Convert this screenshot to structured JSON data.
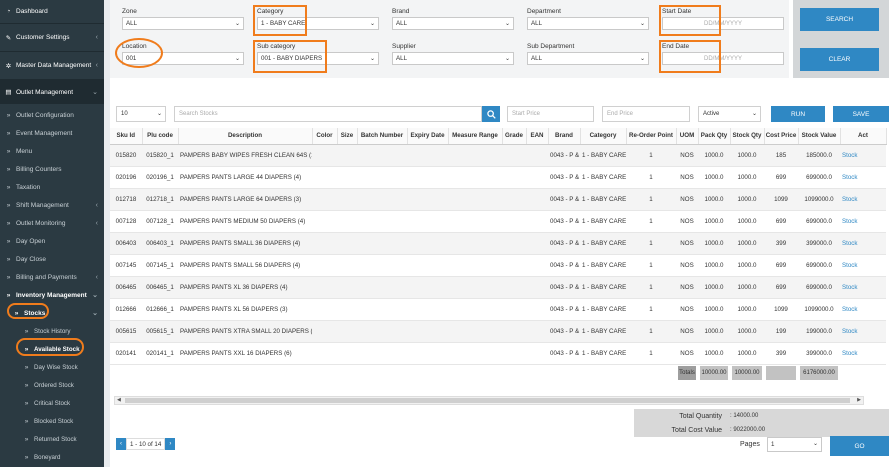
{
  "sidebar": {
    "items": [
      {
        "label": "Dashboard",
        "icon": "tachometer-icon"
      },
      {
        "label": "Customer Settings",
        "icon": "wrench-icon"
      },
      {
        "label": "Master Data Management",
        "icon": "gear-icon"
      },
      {
        "label": "Outlet Management",
        "icon": "store-icon"
      },
      {
        "label": "Outlet Configuration"
      },
      {
        "label": "Event Management"
      },
      {
        "label": "Menu"
      },
      {
        "label": "Billing Counters"
      },
      {
        "label": "Taxation"
      },
      {
        "label": "Shift Management"
      },
      {
        "label": "Outlet Monitoring"
      },
      {
        "label": "Day Open"
      },
      {
        "label": "Day Close"
      },
      {
        "label": "Billing and Payments"
      },
      {
        "label": "Inventory Management"
      },
      {
        "label": "Stocks"
      },
      {
        "label": "Stock History"
      },
      {
        "label": "Available Stock"
      },
      {
        "label": "Day Wise Stock"
      },
      {
        "label": "Ordered Stock"
      },
      {
        "label": "Critical Stock"
      },
      {
        "label": "Blocked Stock"
      },
      {
        "label": "Returned Stock"
      },
      {
        "label": "Boneyard"
      }
    ]
  },
  "filters": {
    "zone": {
      "label": "Zone",
      "value": "ALL"
    },
    "category": {
      "label": "Category",
      "value": "1 - BABY CARE"
    },
    "brand": {
      "label": "Brand",
      "value": "ALL"
    },
    "department": {
      "label": "Department",
      "value": "ALL"
    },
    "start_date": {
      "label": "Start Date",
      "placeholder": "DD/MM/YYYY"
    },
    "location": {
      "label": "Location",
      "value": "001"
    },
    "sub_category": {
      "label": "Sub category",
      "value": "001 - BABY DIAPERS"
    },
    "supplier": {
      "label": "Supplier",
      "value": "ALL"
    },
    "sub_department": {
      "label": "Sub Department",
      "value": "ALL"
    },
    "end_date": {
      "label": "End Date",
      "placeholder": "DD/MM/YYYY"
    }
  },
  "buttons": {
    "search": "SEARCH",
    "clear": "CLEAR",
    "run": "RUN",
    "save": "SAVE",
    "go": "GO"
  },
  "toolbar": {
    "page_size": "10",
    "search_placeholder": "Search Stocks",
    "start_price_placeholder": "Start Price",
    "end_price_placeholder": "End Price",
    "status": "Active"
  },
  "table": {
    "headers": [
      "Sku Id",
      "Plu code",
      "Description",
      "Color",
      "Size",
      "Batch Number",
      "Expiry Date",
      "Measure Range",
      "Grade",
      "EAN",
      "Brand",
      "Category",
      "Re-Order Point",
      "UOM",
      "Pack Qty",
      "Stock Qty",
      "Cost Price",
      "Stock Value",
      "Act"
    ],
    "rows": [
      [
        "015820",
        "015820_1",
        "PAMPERS BABY WIPES FRESH CLEAN 64S (12)",
        "0043 - P & G",
        "1 - BABY CARE",
        "1",
        "NOS",
        "1000.0",
        "1000.0",
        "185",
        "185000.0",
        "Stock"
      ],
      [
        "020196",
        "020196_1",
        "PAMPERS PANTS LARGE 44 DIAPERS (4)",
        "0043 - P & G",
        "1 - BABY CARE",
        "1",
        "NOS",
        "1000.0",
        "1000.0",
        "699",
        "699000.0",
        "Stock"
      ],
      [
        "012718",
        "012718_1",
        "PAMPERS PANTS LARGE 64 DIAPERS (3)",
        "0043 - P & G",
        "1 - BABY CARE",
        "1",
        "NOS",
        "1000.0",
        "1000.0",
        "1099",
        "1099000.0",
        "Stock"
      ],
      [
        "007128",
        "007128_1",
        "PAMPERS PANTS MEDIUM 50 DIAPERS (4)",
        "0043 - P & G",
        "1 - BABY CARE",
        "1",
        "NOS",
        "1000.0",
        "1000.0",
        "699",
        "699000.0",
        "Stock"
      ],
      [
        "006403",
        "006403_1",
        "PAMPERS PANTS SMALL 36 DIAPERS (4)",
        "0043 - P & G",
        "1 - BABY CARE",
        "1",
        "NOS",
        "1000.0",
        "1000.0",
        "399",
        "399000.0",
        "Stock"
      ],
      [
        "007145",
        "007145_1",
        "PAMPERS PANTS SMALL 56 DIAPERS (4)",
        "0043 - P & G",
        "1 - BABY CARE",
        "1",
        "NOS",
        "1000.0",
        "1000.0",
        "699",
        "699000.0",
        "Stock"
      ],
      [
        "006465",
        "006465_1",
        "PAMPERS PANTS XL 36 DIAPERS (4)",
        "0043 - P & G",
        "1 - BABY CARE",
        "1",
        "NOS",
        "1000.0",
        "1000.0",
        "699",
        "699000.0",
        "Stock"
      ],
      [
        "012666",
        "012666_1",
        "PAMPERS PANTS XL 56 DIAPERS (3)",
        "0043 - P & G",
        "1 - BABY CARE",
        "1",
        "NOS",
        "1000.0",
        "1000.0",
        "1099",
        "1099000.0",
        "Stock"
      ],
      [
        "005615",
        "005615_1",
        "PAMPERS PANTS XTRA SMALL 20 DIAPERS (12)",
        "0043 - P & G",
        "1 - BABY CARE",
        "1",
        "NOS",
        "1000.0",
        "1000.0",
        "199",
        "199000.0",
        "Stock"
      ],
      [
        "020141",
        "020141_1",
        "PAMPERS PANTS XXL 16 DIAPERS (6)",
        "0043 - P & G",
        "1 - BABY CARE",
        "1",
        "NOS",
        "1000.0",
        "1000.0",
        "399",
        "399000.0",
        "Stock"
      ]
    ],
    "totals": {
      "label": "Totals",
      "pack_qty": "10000.00",
      "stock_qty": "10000.00",
      "stock_value": "6176000.00"
    }
  },
  "summary": {
    "total_quantity_label": "Total Quantity",
    "total_quantity": ": 14000.00",
    "total_cost_label": "Total Cost Value",
    "total_cost": ": 9022000.00"
  },
  "pager": {
    "info": "1 - 10 of 14",
    "pages_label": "Pages",
    "page_value": "1"
  },
  "colors": {
    "sidebar": "#2b3a42",
    "accent": "#2f88c4",
    "highlight": "#f07c1c"
  }
}
